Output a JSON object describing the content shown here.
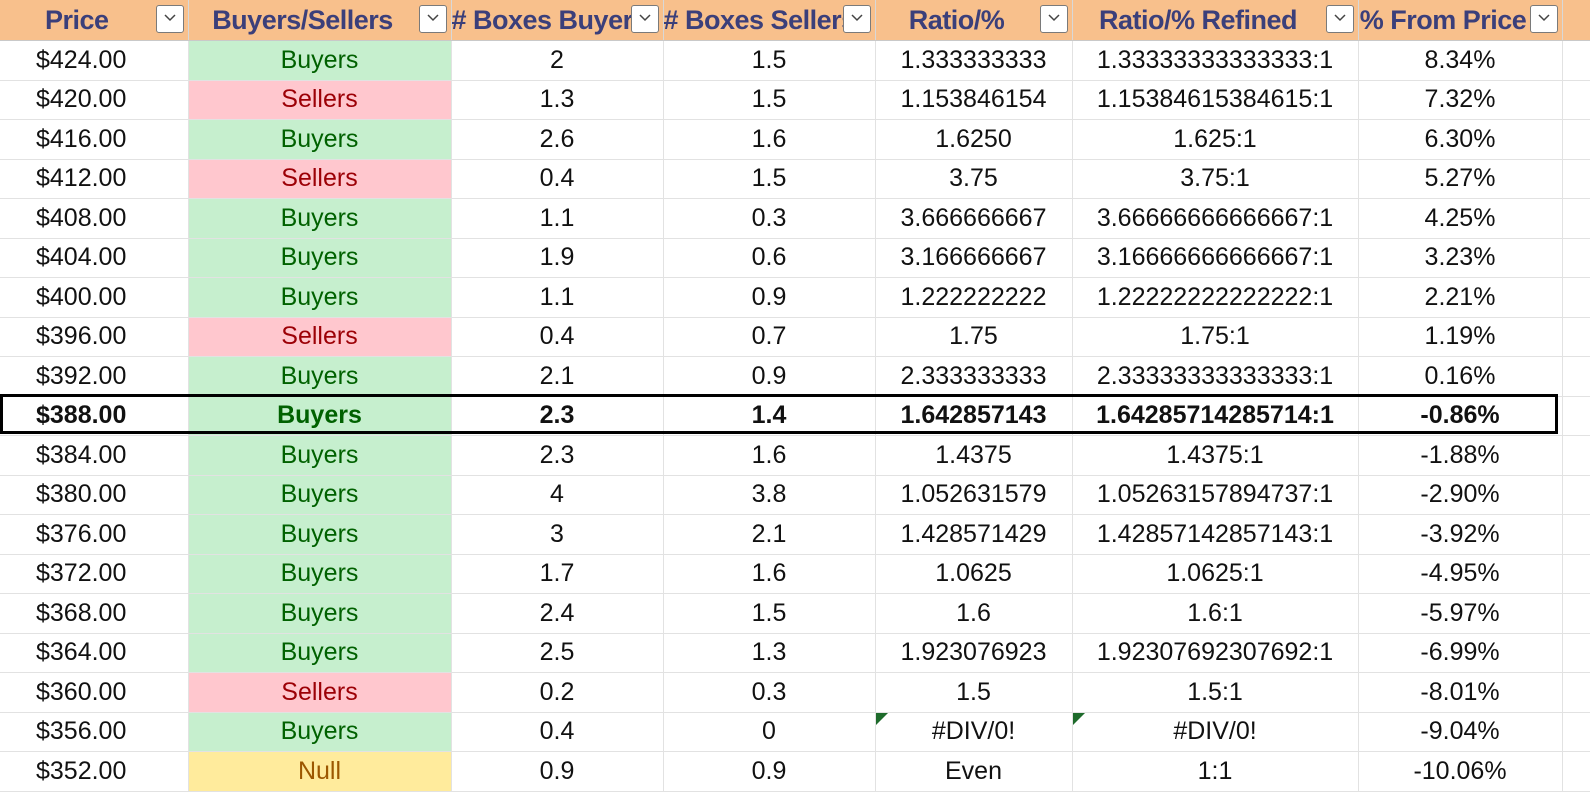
{
  "columns": [
    "Price",
    "Buyers/Sellers",
    "# Boxes Buyers",
    "# Boxes Sellers",
    "Ratio/%",
    "Ratio/% Refined",
    "% From Price"
  ],
  "colors": {
    "header_bg": "#f8c08c",
    "header_text": "#3b3f7a",
    "buyers_bg": "#c6efce",
    "buyers_text": "#006100",
    "sellers_bg": "#ffc7ce",
    "sellers_text": "#9c0006",
    "null_bg": "#ffeb9c",
    "null_text": "#9c5700"
  },
  "icons": {
    "filter": "dropdown-filter-icon",
    "error": "error-indicator-icon"
  },
  "rows": [
    {
      "price": "$424.00",
      "side": "Buyers",
      "buyers": "2",
      "sellers": "1.5",
      "ratio": "1.333333333",
      "refined": "1.33333333333333:1",
      "from": "8.34%"
    },
    {
      "price": "$420.00",
      "side": "Sellers",
      "buyers": "1.3",
      "sellers": "1.5",
      "ratio": "1.153846154",
      "refined": "1.15384615384615:1",
      "from": "7.32%"
    },
    {
      "price": "$416.00",
      "side": "Buyers",
      "buyers": "2.6",
      "sellers": "1.6",
      "ratio": "1.6250",
      "refined": "1.625:1",
      "from": "6.30%"
    },
    {
      "price": "$412.00",
      "side": "Sellers",
      "buyers": "0.4",
      "sellers": "1.5",
      "ratio": "3.75",
      "refined": "3.75:1",
      "from": "5.27%"
    },
    {
      "price": "$408.00",
      "side": "Buyers",
      "buyers": "1.1",
      "sellers": "0.3",
      "ratio": "3.666666667",
      "refined": "3.66666666666667:1",
      "from": "4.25%"
    },
    {
      "price": "$404.00",
      "side": "Buyers",
      "buyers": "1.9",
      "sellers": "0.6",
      "ratio": "3.166666667",
      "refined": "3.16666666666667:1",
      "from": "3.23%"
    },
    {
      "price": "$400.00",
      "side": "Buyers",
      "buyers": "1.1",
      "sellers": "0.9",
      "ratio": "1.222222222",
      "refined": "1.22222222222222:1",
      "from": "2.21%"
    },
    {
      "price": "$396.00",
      "side": "Sellers",
      "buyers": "0.4",
      "sellers": "0.7",
      "ratio": "1.75",
      "refined": "1.75:1",
      "from": "1.19%"
    },
    {
      "price": "$392.00",
      "side": "Buyers",
      "buyers": "2.1",
      "sellers": "0.9",
      "ratio": "2.333333333",
      "refined": "2.33333333333333:1",
      "from": "0.16%"
    },
    {
      "price": "$388.00",
      "side": "Buyers",
      "buyers": "2.3",
      "sellers": "1.4",
      "ratio": "1.642857143",
      "refined": "1.64285714285714:1",
      "from": "-0.86%",
      "current": true
    },
    {
      "price": "$384.00",
      "side": "Buyers",
      "buyers": "2.3",
      "sellers": "1.6",
      "ratio": "1.4375",
      "refined": "1.4375:1",
      "from": "-1.88%"
    },
    {
      "price": "$380.00",
      "side": "Buyers",
      "buyers": "4",
      "sellers": "3.8",
      "ratio": "1.052631579",
      "refined": "1.05263157894737:1",
      "from": "-2.90%"
    },
    {
      "price": "$376.00",
      "side": "Buyers",
      "buyers": "3",
      "sellers": "2.1",
      "ratio": "1.428571429",
      "refined": "1.42857142857143:1",
      "from": "-3.92%"
    },
    {
      "price": "$372.00",
      "side": "Buyers",
      "buyers": "1.7",
      "sellers": "1.6",
      "ratio": "1.0625",
      "refined": "1.0625:1",
      "from": "-4.95%"
    },
    {
      "price": "$368.00",
      "side": "Buyers",
      "buyers": "2.4",
      "sellers": "1.5",
      "ratio": "1.6",
      "refined": "1.6:1",
      "from": "-5.97%"
    },
    {
      "price": "$364.00",
      "side": "Buyers",
      "buyers": "2.5",
      "sellers": "1.3",
      "ratio": "1.923076923",
      "refined": "1.92307692307692:1",
      "from": "-6.99%"
    },
    {
      "price": "$360.00",
      "side": "Sellers",
      "buyers": "0.2",
      "sellers": "0.3",
      "ratio": "1.5",
      "refined": "1.5:1",
      "from": "-8.01%"
    },
    {
      "price": "$356.00",
      "side": "Buyers",
      "buyers": "0.4",
      "sellers": "0",
      "ratio": "#DIV/0!",
      "refined": "#DIV/0!",
      "from": "-9.04%",
      "error": true
    },
    {
      "price": "$352.00",
      "side": "Null",
      "buyers": "0.9",
      "sellers": "0.9",
      "ratio": "Even",
      "refined": "1:1",
      "from": "-10.06%"
    }
  ]
}
